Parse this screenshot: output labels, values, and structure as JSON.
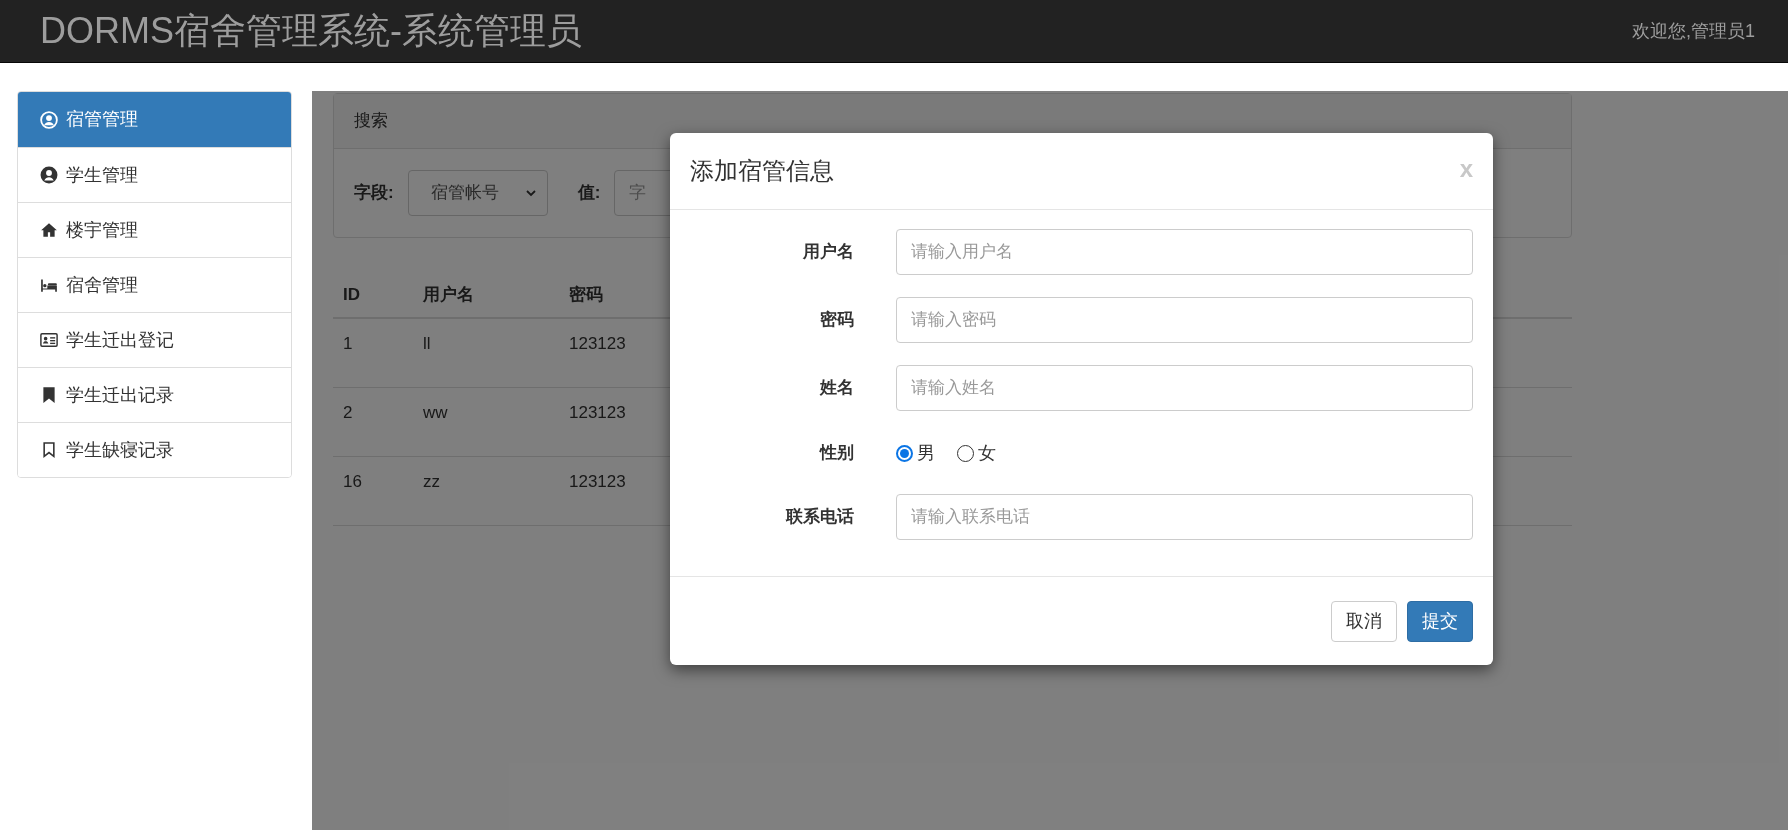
{
  "header": {
    "title": "DORMS宿舍管理系统-系统管理员",
    "welcome": "欢迎您,管理员1"
  },
  "sidebar": {
    "items": [
      {
        "label": "宿管管理",
        "selected": true
      },
      {
        "label": "学生管理",
        "selected": false
      },
      {
        "label": "楼宇管理",
        "selected": false
      },
      {
        "label": "宿舍管理",
        "selected": false
      },
      {
        "label": "学生迁出登记",
        "selected": false
      },
      {
        "label": "学生迁出记录",
        "selected": false
      },
      {
        "label": "学生缺寝记录",
        "selected": false
      }
    ]
  },
  "search": {
    "title": "搜索",
    "field_label": "字段:",
    "field_value": "宿管帐号",
    "value_label": "值:",
    "value_placeholder": "字"
  },
  "table": {
    "columns": [
      "ID",
      "用户名",
      "密码"
    ],
    "rows": [
      [
        "1",
        "ll",
        "123123"
      ],
      [
        "2",
        "ww",
        "123123"
      ],
      [
        "16",
        "zz",
        "123123"
      ]
    ]
  },
  "modal": {
    "title": "添加宿管信息",
    "close": "x",
    "fields": [
      {
        "kind": "text",
        "label": "用户名",
        "placeholder": "请输入用户名"
      },
      {
        "kind": "text",
        "label": "密码",
        "placeholder": "请输入密码"
      },
      {
        "kind": "text",
        "label": "姓名",
        "placeholder": "请输入姓名"
      },
      {
        "kind": "radio",
        "label": "性别",
        "options": [
          {
            "label": "男",
            "selected": true
          },
          {
            "label": "女",
            "selected": false
          }
        ]
      },
      {
        "kind": "text",
        "label": "联系电话",
        "placeholder": "请输入联系电话"
      }
    ],
    "buttons": [
      {
        "label": "取消",
        "kind": "default"
      },
      {
        "label": "提交",
        "kind": "primary"
      }
    ]
  }
}
